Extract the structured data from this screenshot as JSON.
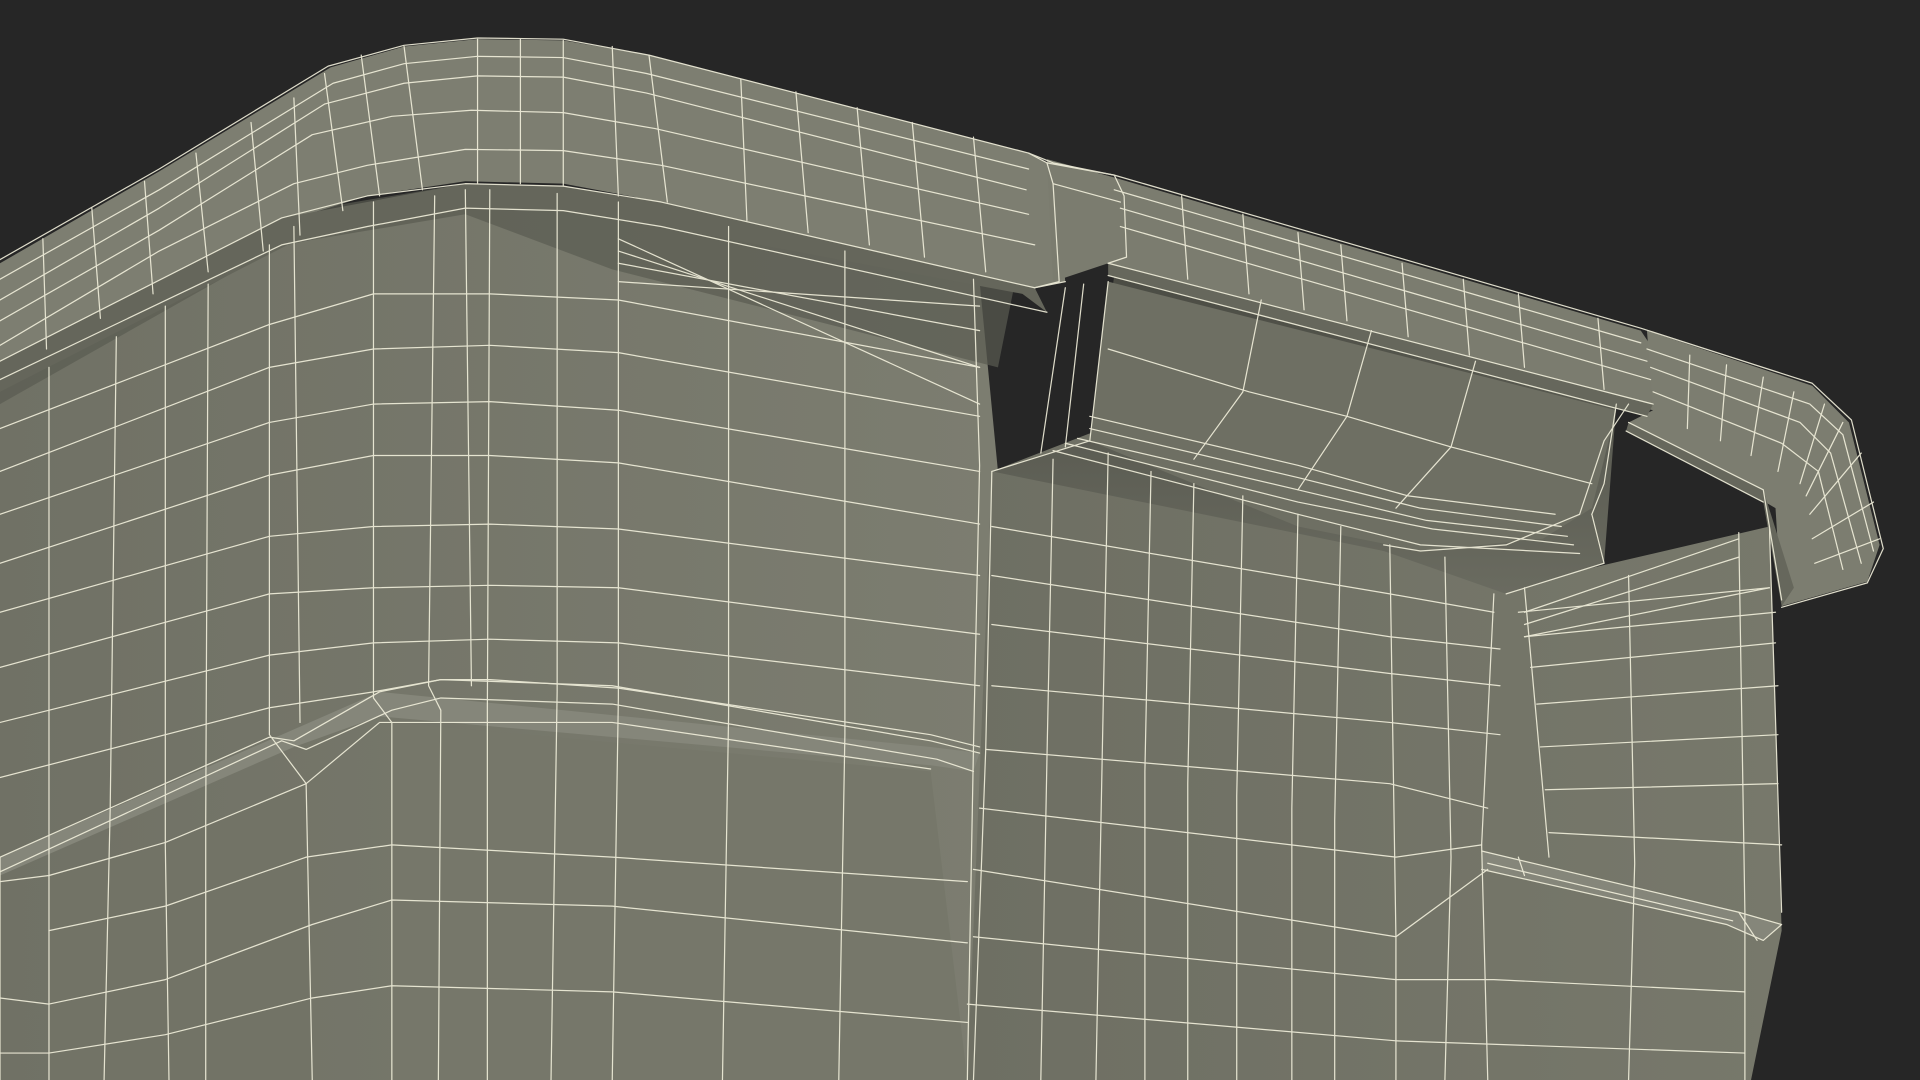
{
  "scene": {
    "subject": "wireframe-3d-render",
    "colors": {
      "background": "#262626",
      "surface": "#797a6d",
      "surface_dark": "#5f6056",
      "surface_shadow": "#4e4f47",
      "wire": "#f2f0dc"
    }
  }
}
